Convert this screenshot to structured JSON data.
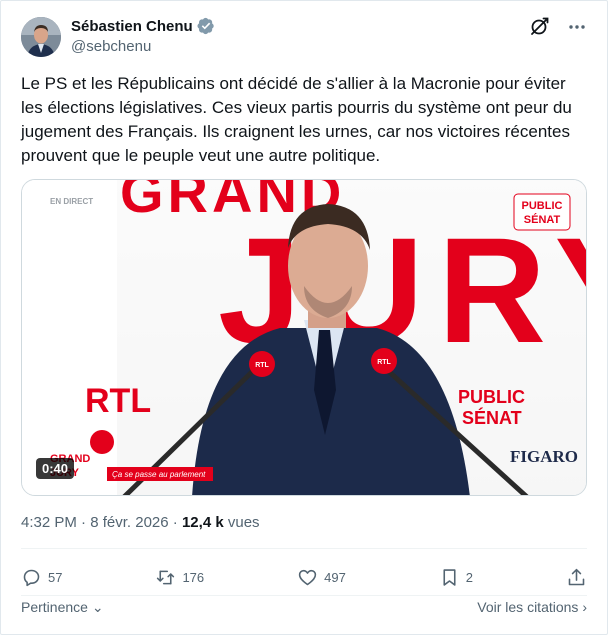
{
  "author": {
    "display_name": "Sébastien Chenu",
    "handle": "@sebchenu"
  },
  "header_icons": [
    "grok-icon",
    "more-icon"
  ],
  "tweet": {
    "text": "Le PS et les Républicains ont décidé de s'allier à la Macronie pour éviter les élections législatives. Ces vieux partis pourris du système ont peur du jugement des Français. Ils craignent les urnes, car nos victoires récentes prouvent que le peuple veut une autre politique."
  },
  "video": {
    "duration": "0:40",
    "overlay": {
      "live_tag": "EN DIRECT",
      "backdrop_top": "GRAND",
      "backdrop_main": "JURY",
      "rtl": "RTL",
      "channel_top_line1": "PUBLIC",
      "channel_top_line2": "SÉNAT",
      "channel_side_line1": "PUBLIC",
      "channel_side_line2": "SÉNAT",
      "figaro": "FIGARO",
      "lower_third_logo_1": "GRAND",
      "lower_third_logo_2": "JURY",
      "lower_third": "Ça se passe au parlement",
      "mic_label": "RTL"
    }
  },
  "meta": {
    "time": "4:32 PM",
    "separator": "·",
    "date": "8 févr. 2026",
    "views_count": "12,4 k",
    "views_label": "vues"
  },
  "actions": {
    "replies": "57",
    "reposts": "176",
    "likes": "497",
    "bookmarks": "2"
  },
  "footer": {
    "relevance": "Pertinence",
    "quotes": "Voir les citations"
  },
  "colors": {
    "text": "#0f1419",
    "secondary": "#536471",
    "verified": "#829aab",
    "brand_red": "#e3001b"
  }
}
